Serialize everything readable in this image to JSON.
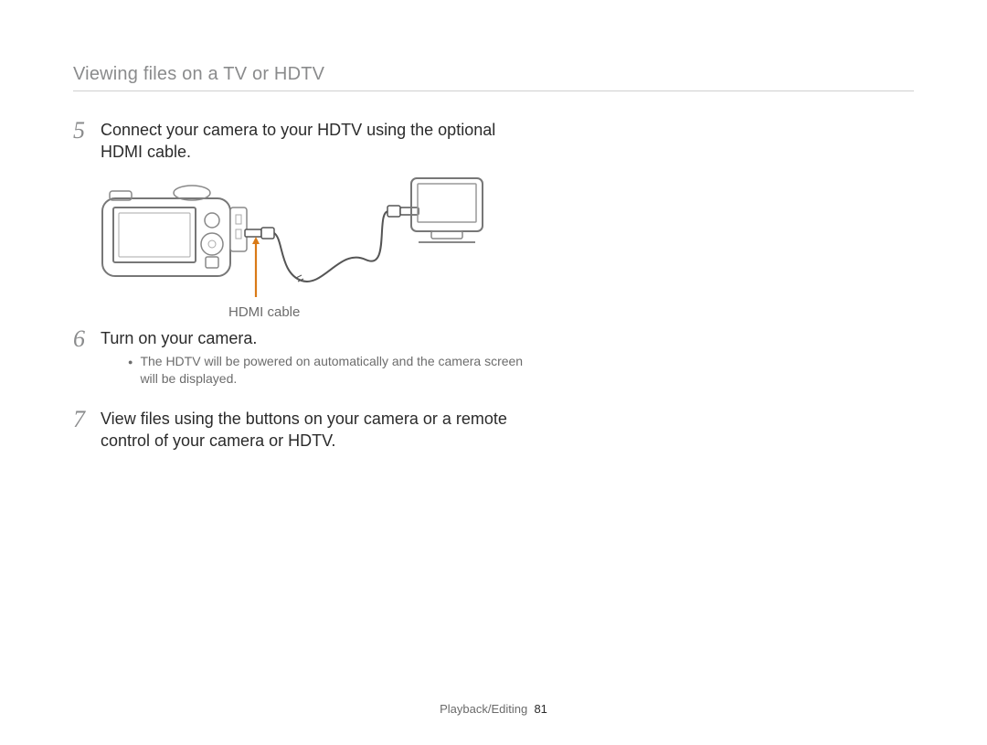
{
  "header": {
    "title": "Viewing files on a TV or HDTV"
  },
  "steps": {
    "s5": {
      "num": "5",
      "text": "Connect your camera to your HDTV using the optional HDMI cable."
    },
    "s6": {
      "num": "6",
      "text": "Turn on your camera.",
      "sub": "The HDTV will be powered on automatically and the camera screen will be displayed."
    },
    "s7": {
      "num": "7",
      "text": "View files using the buttons on your camera or a remote control of your camera or HDTV."
    }
  },
  "diagram": {
    "caption": "HDMI cable"
  },
  "footer": {
    "section": "Playback/Editing",
    "page": "81"
  }
}
